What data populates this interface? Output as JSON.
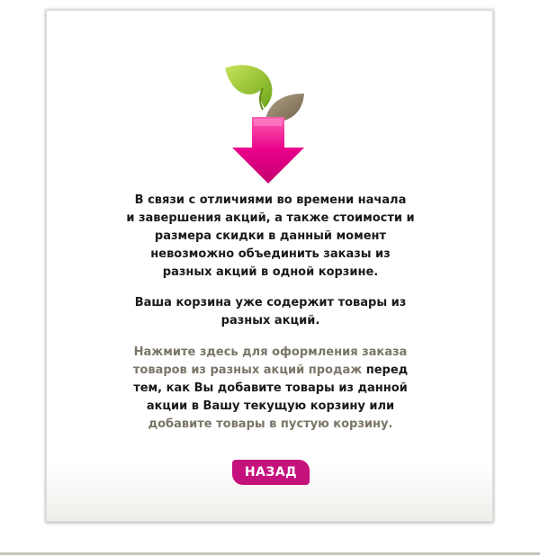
{
  "dialog": {
    "message_lines": [
      "В связи с отличиями во времени начала",
      "и завершения акций, а также стоимости и",
      "размера скидки в данный момент",
      "невозможно объединить заказы из",
      "разных акций в одной корзине."
    ],
    "cart_lines": [
      "Ваша корзина уже содержит товары из",
      "разных акций."
    ],
    "action": {
      "link1_line1": "Нажмите здесь для оформления заказа",
      "link1_line2a": "товаров из разных акций продаж",
      "text_line2b": " перед",
      "text_line3": "тем, как Вы добавите товары из данной",
      "text_line4": "акции в Вашу текущую корзину или",
      "link2_line5": "добавите товары в пустую корзину."
    },
    "back_label": "НАЗАД"
  },
  "colors": {
    "brand_pink": "#c5117c",
    "leaf_green": "#8dc21f",
    "leaf_brown": "#8c7b63",
    "arrow_pink": "#e5007e",
    "muted_text": "#7b7568"
  },
  "icons": {
    "logo": "leaf-arrow-logo-icon"
  }
}
